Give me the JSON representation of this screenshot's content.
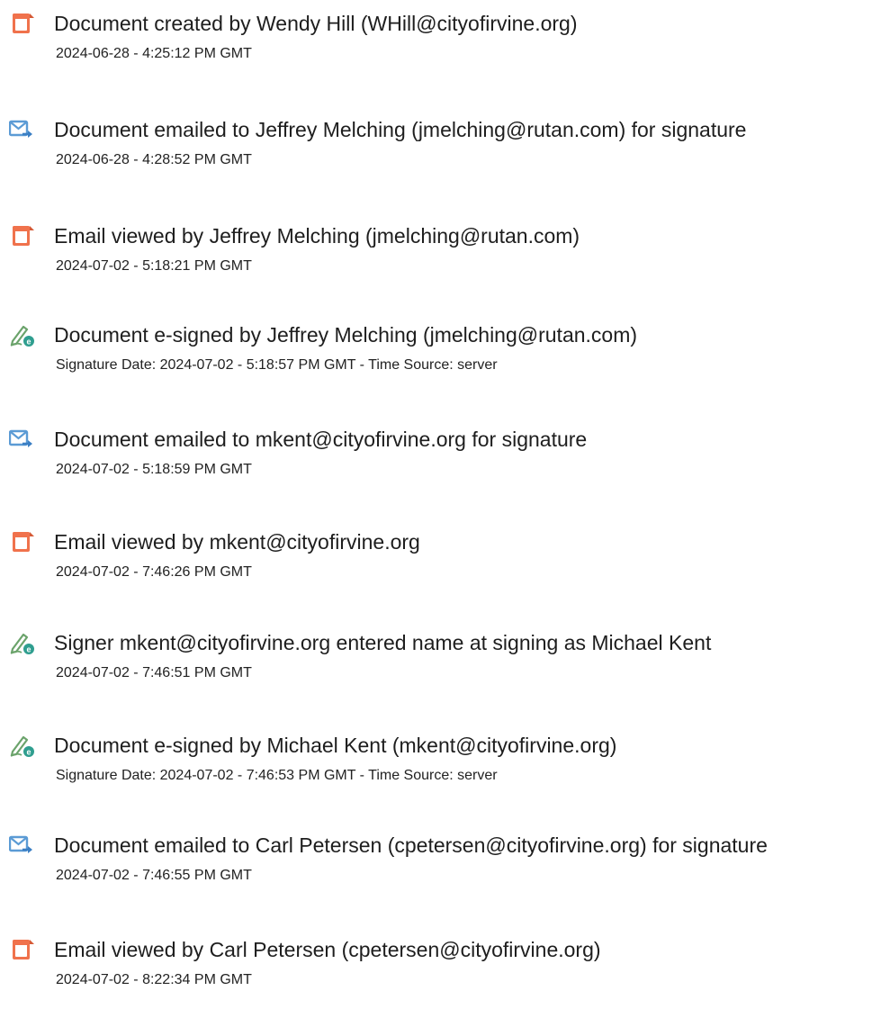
{
  "events": [
    {
      "icon": "document-icon",
      "title": "Document created by Wendy Hill (WHill@cityofirvine.org)",
      "detail": "2024-06-28 - 4:25:12 PM GMT"
    },
    {
      "icon": "email-sent-icon",
      "title": "Document emailed to Jeffrey Melching (jmelching@rutan.com) for signature",
      "detail": "2024-06-28 - 4:28:52 PM GMT"
    },
    {
      "icon": "document-icon",
      "title": "Email viewed by Jeffrey Melching (jmelching@rutan.com)",
      "detail": "2024-07-02 - 5:18:21 PM GMT"
    },
    {
      "icon": "e-sign-icon",
      "title": "Document e-signed by Jeffrey Melching (jmelching@rutan.com)",
      "detail": "Signature Date: 2024-07-02 - 5:18:57 PM GMT - Time Source: server"
    },
    {
      "icon": "email-sent-icon",
      "title": "Document emailed to mkent@cityofirvine.org for signature",
      "detail": "2024-07-02 - 5:18:59 PM GMT"
    },
    {
      "icon": "document-icon",
      "title": "Email viewed by mkent@cityofirvine.org",
      "detail": "2024-07-02 - 7:46:26 PM GMT"
    },
    {
      "icon": "e-sign-icon",
      "title": "Signer mkent@cityofirvine.org entered name at signing as Michael Kent",
      "detail": "2024-07-02 - 7:46:51 PM GMT"
    },
    {
      "icon": "e-sign-icon",
      "title": "Document e-signed by Michael Kent (mkent@cityofirvine.org)",
      "detail": "Signature Date: 2024-07-02 - 7:46:53 PM GMT - Time Source: server"
    },
    {
      "icon": "email-sent-icon",
      "title": "Document emailed to Carl Petersen (cpetersen@cityofirvine.org) for signature",
      "detail": "2024-07-02 - 7:46:55 PM GMT"
    },
    {
      "icon": "document-icon",
      "title": "Email viewed by Carl Petersen (cpetersen@cityofirvine.org)",
      "detail": "2024-07-02 - 8:22:34 PM GMT"
    }
  ],
  "colors": {
    "document_icon": "#f0724c",
    "email_icon": "#5b9bd5",
    "sign_icon_pen": "#6ba36b",
    "sign_icon_badge": "#2f9e8f"
  }
}
